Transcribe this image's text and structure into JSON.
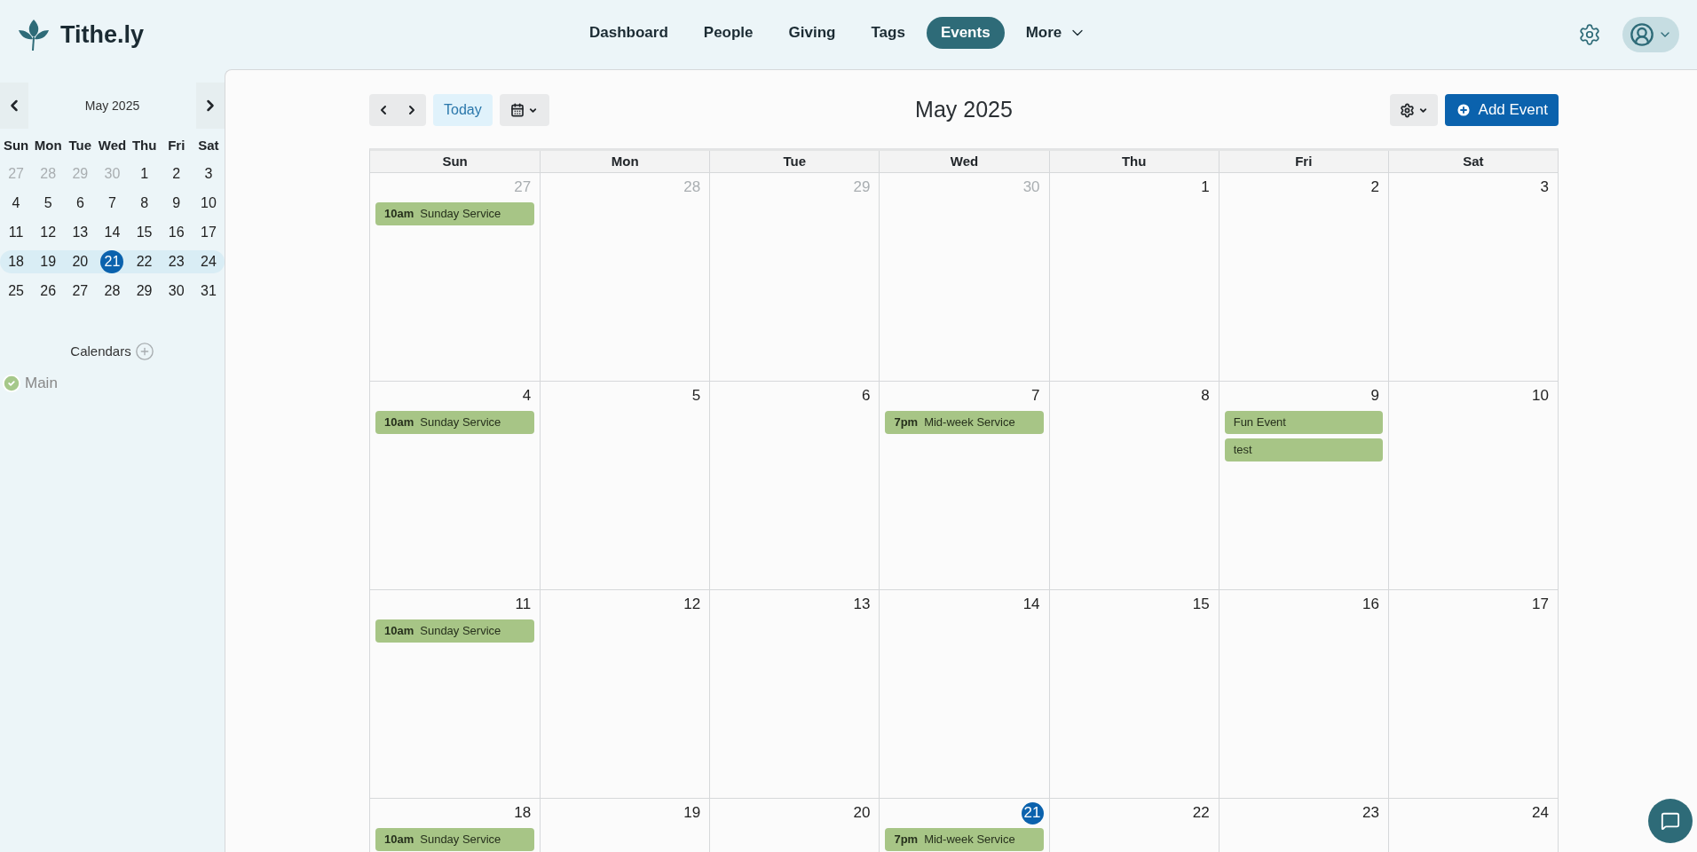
{
  "brand": {
    "name": "Tithe.ly"
  },
  "nav": [
    {
      "label": "Dashboard",
      "selected": false
    },
    {
      "label": "People",
      "selected": false
    },
    {
      "label": "Giving",
      "selected": false
    },
    {
      "label": "Tags",
      "selected": false
    },
    {
      "label": "Events",
      "selected": true
    },
    {
      "label": "More",
      "selected": false,
      "kind": "dropdown"
    }
  ],
  "mini_calendar": {
    "title": "May 2025",
    "weekdays": [
      "Sun",
      "Mon",
      "Tue",
      "Wed",
      "Thu",
      "Fri",
      "Sat"
    ],
    "weeks": [
      {
        "highlighted": false,
        "days": [
          {
            "day": "27",
            "other_month": true,
            "selected": false
          },
          {
            "day": "28",
            "other_month": true,
            "selected": false
          },
          {
            "day": "29",
            "other_month": true,
            "selected": false
          },
          {
            "day": "30",
            "other_month": true,
            "selected": false
          },
          {
            "day": "1",
            "other_month": false,
            "selected": false
          },
          {
            "day": "2",
            "other_month": false,
            "selected": false
          },
          {
            "day": "3",
            "other_month": false,
            "selected": false
          }
        ]
      },
      {
        "highlighted": false,
        "days": [
          {
            "day": "4",
            "other_month": false,
            "selected": false
          },
          {
            "day": "5",
            "other_month": false,
            "selected": false
          },
          {
            "day": "6",
            "other_month": false,
            "selected": false
          },
          {
            "day": "7",
            "other_month": false,
            "selected": false
          },
          {
            "day": "8",
            "other_month": false,
            "selected": false
          },
          {
            "day": "9",
            "other_month": false,
            "selected": false
          },
          {
            "day": "10",
            "other_month": false,
            "selected": false
          }
        ]
      },
      {
        "highlighted": false,
        "days": [
          {
            "day": "11",
            "other_month": false,
            "selected": false
          },
          {
            "day": "12",
            "other_month": false,
            "selected": false
          },
          {
            "day": "13",
            "other_month": false,
            "selected": false
          },
          {
            "day": "14",
            "other_month": false,
            "selected": false
          },
          {
            "day": "15",
            "other_month": false,
            "selected": false
          },
          {
            "day": "16",
            "other_month": false,
            "selected": false
          },
          {
            "day": "17",
            "other_month": false,
            "selected": false
          }
        ]
      },
      {
        "highlighted": true,
        "days": [
          {
            "day": "18",
            "other_month": false,
            "selected": false
          },
          {
            "day": "19",
            "other_month": false,
            "selected": false
          },
          {
            "day": "20",
            "other_month": false,
            "selected": false
          },
          {
            "day": "21",
            "other_month": false,
            "selected": true
          },
          {
            "day": "22",
            "other_month": false,
            "selected": false
          },
          {
            "day": "23",
            "other_month": false,
            "selected": false
          },
          {
            "day": "24",
            "other_month": false,
            "selected": false
          }
        ]
      },
      {
        "highlighted": false,
        "days": [
          {
            "day": "25",
            "other_month": false,
            "selected": false
          },
          {
            "day": "26",
            "other_month": false,
            "selected": false
          },
          {
            "day": "27",
            "other_month": false,
            "selected": false
          },
          {
            "day": "28",
            "other_month": false,
            "selected": false
          },
          {
            "day": "29",
            "other_month": false,
            "selected": false
          },
          {
            "day": "30",
            "other_month": false,
            "selected": false
          },
          {
            "day": "31",
            "other_month": false,
            "selected": false
          }
        ]
      }
    ]
  },
  "calendars": {
    "title": "Calendars",
    "items": [
      {
        "name": "Main",
        "checked": true
      }
    ]
  },
  "toolbar": {
    "today": "Today",
    "title": "May 2025",
    "add_event": "Add Event"
  },
  "month": {
    "weekdays": [
      "Sun",
      "Mon",
      "Tue",
      "Wed",
      "Thu",
      "Fri",
      "Sat"
    ],
    "weeks": [
      [
        {
          "day": "27",
          "other_month": true,
          "today": false,
          "events": [
            {
              "time": "10am",
              "title": "Sunday Service"
            }
          ]
        },
        {
          "day": "28",
          "other_month": true,
          "today": false
        },
        {
          "day": "29",
          "other_month": true,
          "today": false
        },
        {
          "day": "30",
          "other_month": true,
          "today": false
        },
        {
          "day": "1",
          "other_month": false,
          "today": false
        },
        {
          "day": "2",
          "other_month": false,
          "today": false
        },
        {
          "day": "3",
          "other_month": false,
          "today": false
        }
      ],
      [
        {
          "day": "4",
          "other_month": false,
          "today": false,
          "events": [
            {
              "time": "10am",
              "title": "Sunday Service"
            }
          ]
        },
        {
          "day": "5",
          "other_month": false,
          "today": false
        },
        {
          "day": "6",
          "other_month": false,
          "today": false
        },
        {
          "day": "7",
          "other_month": false,
          "today": false,
          "events": [
            {
              "time": "7pm",
              "title": "Mid-week Service"
            }
          ]
        },
        {
          "day": "8",
          "other_month": false,
          "today": false
        },
        {
          "day": "9",
          "other_month": false,
          "today": false,
          "events": [
            {
              "title": "Fun Event"
            },
            {
              "title": "test"
            }
          ]
        },
        {
          "day": "10",
          "other_month": false,
          "today": false
        }
      ],
      [
        {
          "day": "11",
          "other_month": false,
          "today": false,
          "events": [
            {
              "time": "10am",
              "title": "Sunday Service"
            }
          ]
        },
        {
          "day": "12",
          "other_month": false,
          "today": false
        },
        {
          "day": "13",
          "other_month": false,
          "today": false
        },
        {
          "day": "14",
          "other_month": false,
          "today": false
        },
        {
          "day": "15",
          "other_month": false,
          "today": false
        },
        {
          "day": "16",
          "other_month": false,
          "today": false
        },
        {
          "day": "17",
          "other_month": false,
          "today": false
        }
      ],
      [
        {
          "day": "18",
          "other_month": false,
          "today": false,
          "events": [
            {
              "time": "10am",
              "title": "Sunday Service"
            }
          ]
        },
        {
          "day": "19",
          "other_month": false,
          "today": false
        },
        {
          "day": "20",
          "other_month": false,
          "today": false
        },
        {
          "day": "21",
          "other_month": false,
          "today": true,
          "events": [
            {
              "time": "7pm",
              "title": "Mid-week Service"
            }
          ]
        },
        {
          "day": "22",
          "other_month": false,
          "today": false
        },
        {
          "day": "23",
          "other_month": false,
          "today": false
        },
        {
          "day": "24",
          "other_month": false,
          "today": false
        }
      ]
    ]
  }
}
